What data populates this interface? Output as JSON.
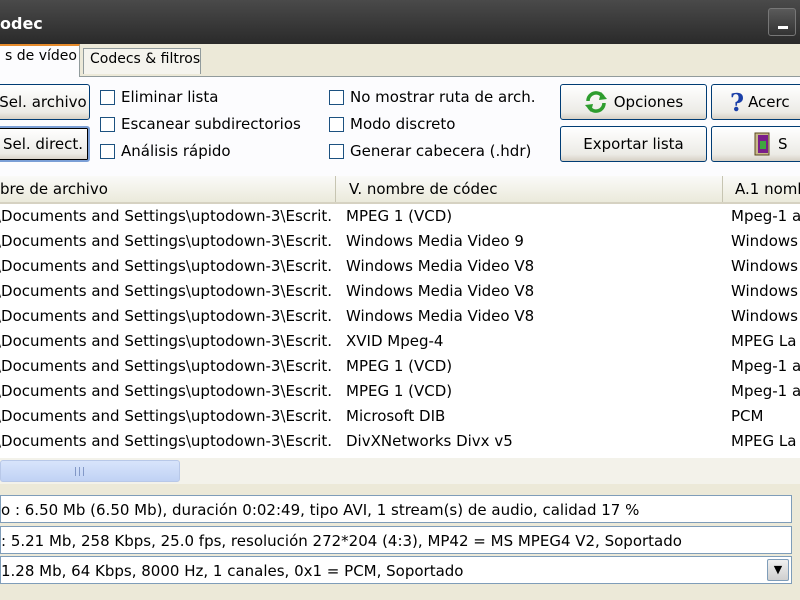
{
  "window": {
    "title": "odec"
  },
  "tabs": [
    {
      "label": "s de vídeo",
      "active": true
    },
    {
      "label": "Codecs & filtros",
      "active": false
    }
  ],
  "toolbar": {
    "sel_archivo": "Sel. archivo",
    "sel_direct": "Sel. direct.",
    "opciones": "Opciones",
    "acerca": "Acerc",
    "exportar": "Exportar lista",
    "salir": "S"
  },
  "checkboxes": {
    "eliminar": "Eliminar lista",
    "escanear": "Escanear subdirectorios",
    "analisis": "Análisis rápido",
    "no_mostrar": "No mostrar ruta de arch.",
    "modo": "Modo discreto",
    "generar": "Generar cabecera (.hdr)"
  },
  "list": {
    "columns": [
      "bre de archivo",
      "V. nombre de códec",
      "A.1 nomb"
    ],
    "rows": [
      {
        "file": "\\Documents and Settings\\uptodown-3\\Escrit...",
        "vcodec": "MPEG 1 (VCD)",
        "acodec": "Mpeg-1 a"
      },
      {
        "file": "\\Documents and Settings\\uptodown-3\\Escrit...",
        "vcodec": "Windows Media Video 9",
        "acodec": "Windows"
      },
      {
        "file": "\\Documents and Settings\\uptodown-3\\Escrit...",
        "vcodec": "Windows Media Video V8",
        "acodec": "Windows"
      },
      {
        "file": "\\Documents and Settings\\uptodown-3\\Escrit...",
        "vcodec": "Windows Media Video V8",
        "acodec": "Windows"
      },
      {
        "file": "\\Documents and Settings\\uptodown-3\\Escrit...",
        "vcodec": "Windows Media Video V8",
        "acodec": "Windows"
      },
      {
        "file": "\\Documents and Settings\\uptodown-3\\Escrit...",
        "vcodec": "XVID Mpeg-4",
        "acodec": "MPEG La"
      },
      {
        "file": "\\Documents and Settings\\uptodown-3\\Escrit...",
        "vcodec": "MPEG 1 (VCD)",
        "acodec": "Mpeg-1 a"
      },
      {
        "file": "\\Documents and Settings\\uptodown-3\\Escrit...",
        "vcodec": "MPEG 1 (VCD)",
        "acodec": "Mpeg-1 a"
      },
      {
        "file": "\\Documents and Settings\\uptodown-3\\Escrit...",
        "vcodec": "Microsoft DIB",
        "acodec": "PCM"
      },
      {
        "file": "\\Documents and Settings\\uptodown-3\\Escrit...",
        "vcodec": "DivXNetworks Divx v5",
        "acodec": "MPEG La"
      }
    ]
  },
  "info": {
    "line1": "o : 6.50 Mb (6.50 Mb), duración 0:02:49, tipo AVI, 1 stream(s) de audio, calidad 17 %",
    "line2": ": 5.21 Mb, 258 Kbps, 25.0 fps, resolución 272*204 (4:3),  MP42 = MS MPEG4 V2, Soportado",
    "line3": " 1.28 Mb, 64 Kbps, 8000 Hz, 1 canales, 0x1 = PCM, Soportado"
  },
  "icons": {
    "refresh": "refresh-icon",
    "help": "help-icon",
    "exit": "exit-icon"
  },
  "colors": {
    "titlebar": "#2a2a2a",
    "tab_accent": "#e68b2c",
    "refresh_green": "#2e9d2e",
    "help_blue": "#1a3fa8"
  }
}
